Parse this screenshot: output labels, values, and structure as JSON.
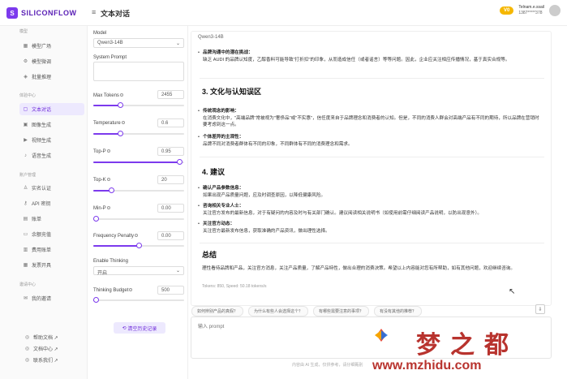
{
  "app": {
    "logo_text": "SILICONFLOW",
    "page_title": "文本对话"
  },
  "topbar": {
    "vip_label": "V0",
    "user_name": "Telnam.e.ssail",
    "user_id": "1387*****378"
  },
  "sidebar": {
    "section_models": "模型",
    "items_models": [
      {
        "label": "模型广场",
        "icon": "grid-icon"
      },
      {
        "label": "模型微调",
        "icon": "tune-icon"
      },
      {
        "label": "批量推理",
        "icon": "batch-icon"
      }
    ],
    "section_playground": "体验中心",
    "items_playground": [
      {
        "label": "文本对话",
        "icon": "chat-icon"
      },
      {
        "label": "图像生成",
        "icon": "image-icon"
      },
      {
        "label": "视频生成",
        "icon": "video-icon"
      },
      {
        "label": "语音生成",
        "icon": "audio-icon"
      }
    ],
    "section_account": "账户管理",
    "items_account": [
      {
        "label": "实名认证",
        "icon": "verify-icon"
      },
      {
        "label": "API 密钥",
        "icon": "key-icon"
      },
      {
        "label": "账单",
        "icon": "bill-icon"
      },
      {
        "label": "余额充值",
        "icon": "wallet-icon"
      },
      {
        "label": "费用账单",
        "icon": "receipt-icon"
      },
      {
        "label": "发票开具",
        "icon": "invoice-icon"
      }
    ],
    "section_invite": "邀请中心",
    "items_invite": [
      {
        "label": "我的邀请",
        "icon": "gift-icon"
      }
    ],
    "bottom_links": [
      {
        "label": "帮助文档 ↗",
        "icon": "doc-icon"
      },
      {
        "label": "文档中心 ↗",
        "icon": "book-icon"
      },
      {
        "label": "联系我们 ↗",
        "icon": "contact-icon"
      }
    ]
  },
  "settings": {
    "model_label": "Model",
    "model_value": "Qwen3-14B",
    "system_prompt_label": "System Prompt",
    "max_tokens_label": "Max Tokens",
    "max_tokens_value": "2455",
    "max_tokens_fraction": 0.3,
    "temperature_label": "Temperature",
    "temperature_value": "0.6",
    "temperature_fraction": 0.3,
    "top_p_label": "Top-P",
    "top_p_value": "0.95",
    "top_p_fraction": 0.95,
    "top_k_label": "Top-K",
    "top_k_value": "20",
    "top_k_fraction": 0.2,
    "min_p_label": "Min-P",
    "min_p_value": "0.00",
    "min_p_fraction": 0.0,
    "freq_label": "Frequency Penalty",
    "freq_value": "0.00",
    "freq_fraction": 0.5,
    "thinking_label": "Enable Thinking",
    "thinking_value": "开启",
    "budget_label": "Thinking Budget",
    "budget_value": "500",
    "budget_fraction": 0.02,
    "clear_label": "清空历史记录"
  },
  "chat": {
    "model_tag": "Qwen3-14B",
    "p1_title": "品牌沟通中的潜在挑战：",
    "p1_text": "缺乏 AUDI 的品牌认知度，乙醇香料可能导致\"打折扣\"的印象，从而造成信任（或者谣言）等等问题。因此，企业应关注相应传播情况，基于真实合规等。",
    "h3": "3. 文化与认知误区",
    "b1_title": "传统观念的影响：",
    "b1_text": "在消费文化中，\"高端品牌\"常被视为\"奢侈品\"或\"不实惠\"，信任度来自于品牌理念和消费者的认知。但是，不同的消费人群会对高端产品有不同的期待，所以品牌在营销时要考虑到这一点。",
    "b2_title": "个体差异的主观性：",
    "b2_text": "品牌不同对消费者群体有不同的印象，不同群体有不同的消费理念和需求。",
    "h4": "4. 建议",
    "c1_title": "确认产品参数信息：",
    "c1_text": "如果出现产品质量问题，应及时调查原因，以降低健康风险。",
    "c2_title": "咨询相关专业人士：",
    "c2_text": "关注官方发布的最新信息，对于有疑问的内容及时与有关部门确认。建议阅读相关说明书（如使用前需仔细阅读产品说明，以防出现意外）。",
    "c3_title": "关注官方动态：",
    "c3_text": "关注官方最新发布信息，获取准确的产品资讯，做出理性选择。",
    "summary_h": "总结",
    "summary_text": "理性看待品牌和产品，关注官方消息，关注产品质量，了解产品特性，做出合理的消费决策。希望以上内容能对您有所帮助，如有其他问题，欢迎继续咨询。",
    "meta": "Tokens: 850, Speed: 50.18 tokens/s"
  },
  "suggestions": [
    "如何辨别产品的真假？",
    "为什么有些人会选择这个？",
    "有哪些需要注意的事项？",
    "有没有其他的推荐？"
  ],
  "input": {
    "placeholder": "输入 prompt"
  },
  "footer_note": "内容由 AI 生成，仅供参考，请仔细甄别",
  "watermark": {
    "cn": "梦之都",
    "url": "www.mzhidu.com"
  }
}
